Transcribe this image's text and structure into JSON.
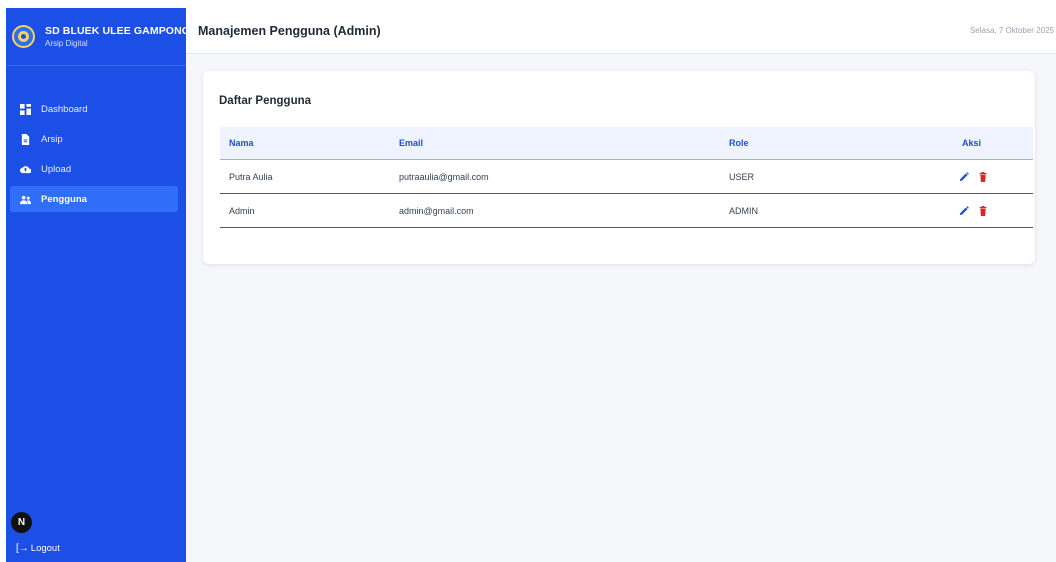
{
  "sidebar": {
    "brand_title": "SD BLUEK ULEE GAMPONG",
    "brand_subtitle": "Arsip Digital",
    "items": [
      {
        "label": "Dashboard",
        "icon": "dashboard-icon"
      },
      {
        "label": "Arsip",
        "icon": "file-icon"
      },
      {
        "label": "Upload",
        "icon": "cloud-upload-icon"
      },
      {
        "label": "Pengguna",
        "icon": "users-icon",
        "active": true
      }
    ],
    "logout_label": "Logout",
    "badge_letter": "N"
  },
  "header": {
    "title": "Manajemen Pengguna (Admin)",
    "date": "Selasa, 7 Oktober 2025"
  },
  "card": {
    "title": "Daftar Pengguna",
    "columns": [
      "Nama",
      "Email",
      "Role",
      "Aksi"
    ],
    "rows": [
      {
        "nama": "Putra Aulia",
        "email": "putraaulia@gmail.com",
        "role": "USER"
      },
      {
        "nama": "Admin",
        "email": "admin@gmail.com",
        "role": "ADMIN"
      }
    ]
  },
  "colors": {
    "sidebar": "#1c4fe6",
    "active_item": "#2f6ff8",
    "edit_icon": "#1d4ed8",
    "delete_icon": "#dc2626"
  }
}
